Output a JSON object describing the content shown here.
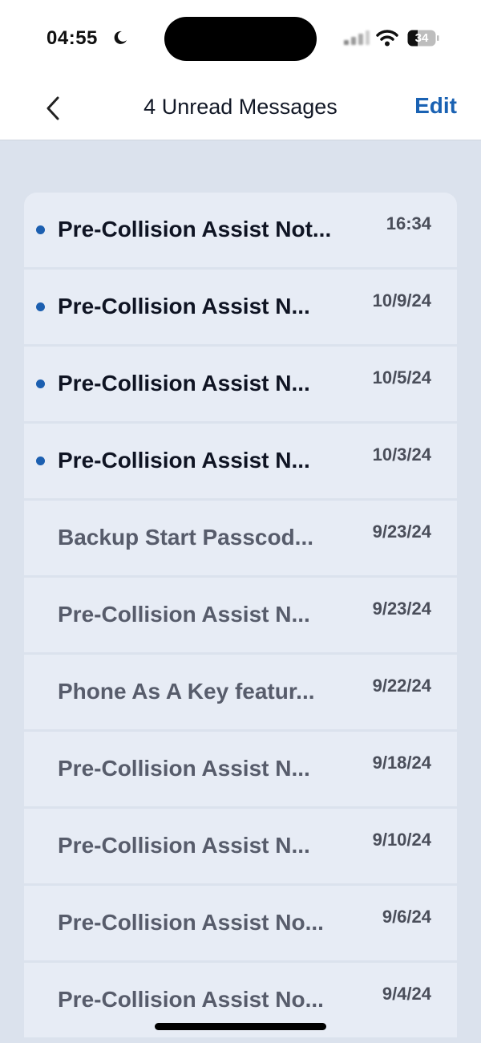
{
  "status_bar": {
    "time": "04:55",
    "battery": "34"
  },
  "nav": {
    "title": "4 Unread Messages",
    "edit_label": "Edit"
  },
  "messages": [
    {
      "subject": "Pre-Collision Assist Not...",
      "date": "16:34",
      "unread": true
    },
    {
      "subject": "Pre-Collision Assist N...",
      "date": "10/9/24",
      "unread": true
    },
    {
      "subject": "Pre-Collision Assist N...",
      "date": "10/5/24",
      "unread": true
    },
    {
      "subject": "Pre-Collision Assist N...",
      "date": "10/3/24",
      "unread": true
    },
    {
      "subject": "Backup Start Passcod...",
      "date": "9/23/24",
      "unread": false
    },
    {
      "subject": "Pre-Collision Assist N...",
      "date": "9/23/24",
      "unread": false
    },
    {
      "subject": "Phone As A Key featur...",
      "date": "9/22/24",
      "unread": false
    },
    {
      "subject": "Pre-Collision Assist N...",
      "date": "9/18/24",
      "unread": false
    },
    {
      "subject": "Pre-Collision Assist N...",
      "date": "9/10/24",
      "unread": false
    },
    {
      "subject": "Pre-Collision Assist No...",
      "date": "9/6/24",
      "unread": false
    },
    {
      "subject": "Pre-Collision Assist No...",
      "date": "9/4/24",
      "unread": false
    }
  ],
  "colors": {
    "accent": "#1a62b3",
    "unread_dot": "#1c5fb0",
    "list_background": "#dbe2ed",
    "row_background": "#e7ecf5"
  },
  "icons": {
    "back": "chevron-left-icon",
    "moon": "moon-icon",
    "signal": "cellular-signal-icon",
    "wifi": "wifi-icon",
    "battery": "battery-icon"
  }
}
